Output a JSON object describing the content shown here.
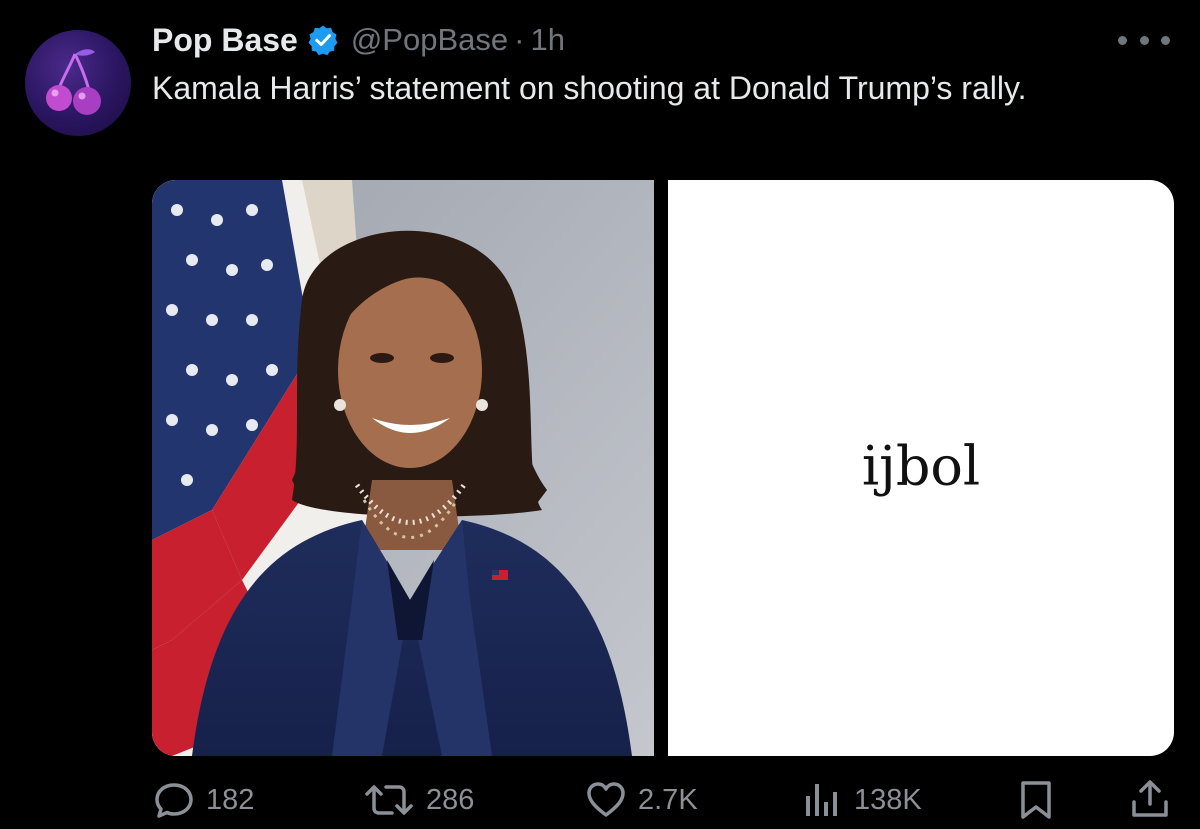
{
  "tweet": {
    "display_name": "Pop Base",
    "handle": "@PopBase",
    "separator": "·",
    "time": "1h",
    "text": "Kamala Harris’ statement on shooting at Donald Trump’s rally."
  },
  "media": {
    "card_text": "ijbol"
  },
  "stats": {
    "replies": "182",
    "reposts": "286",
    "likes": "2.7K",
    "views": "138K"
  },
  "colors": {
    "background": "#000000",
    "text_primary": "#e7e9ea",
    "text_secondary": "#71767b",
    "verified_blue": "#1d9bf0"
  },
  "icons": {
    "avatar": "cherries-logo",
    "verified": "verified-badge-icon",
    "more": "more-dots-icon",
    "reply": "reply-icon",
    "repost": "repost-icon",
    "like": "heart-icon",
    "views": "views-chart-icon",
    "bookmark": "bookmark-icon",
    "share": "share-icon"
  }
}
